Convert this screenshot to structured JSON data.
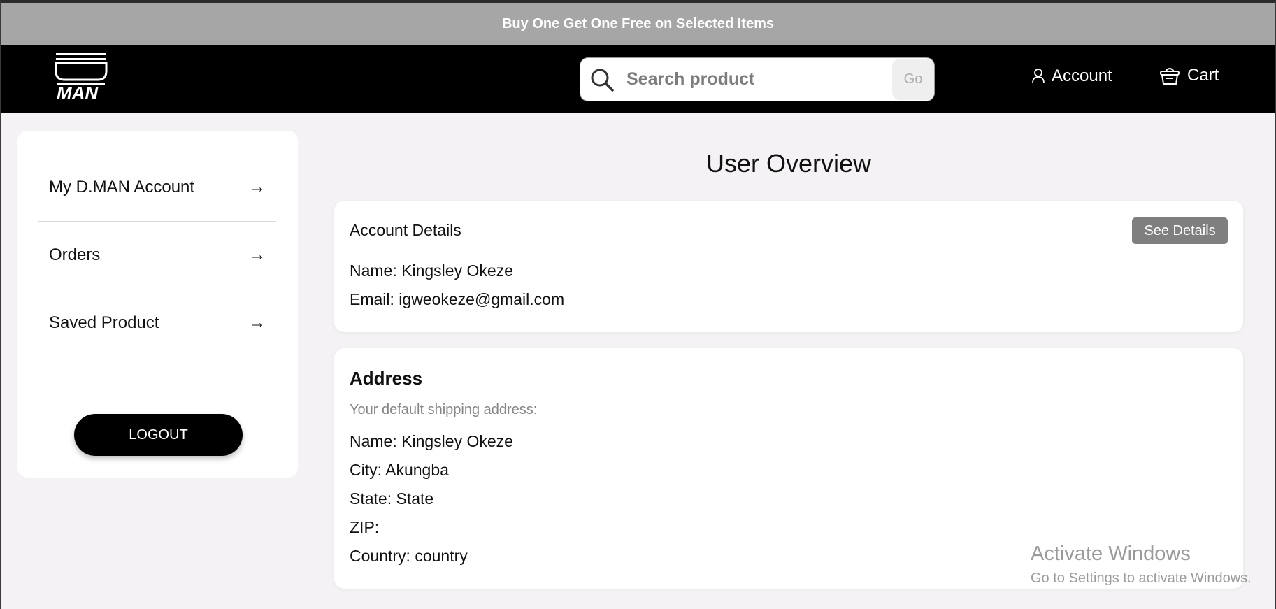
{
  "promo": {
    "text": "Buy One Get One Free on Selected Items"
  },
  "header": {
    "logo_text": "MAN",
    "search": {
      "placeholder": "Search product",
      "value": "",
      "go_label": "Go"
    },
    "account_label": "Account",
    "cart_label": "Cart"
  },
  "sidebar": {
    "items": [
      {
        "label": "My D.MAN Account",
        "arrow": "→"
      },
      {
        "label": "Orders",
        "arrow": "→"
      },
      {
        "label": "Saved Product",
        "arrow": "→"
      }
    ],
    "logout_label": "LOGOUT"
  },
  "main": {
    "title": "User Overview",
    "account": {
      "label": "Account Details",
      "see_details_label": "See Details",
      "name": "Name: Kingsley Okeze",
      "email": "Email: igweokeze@gmail.com"
    },
    "address": {
      "title": "Address",
      "subtitle": "Your default shipping address:",
      "name": "Name: Kingsley Okeze",
      "city": "City: Akungba",
      "state": "State: State",
      "zip": "ZIP:",
      "country": "Country: country"
    }
  },
  "watermark": {
    "line1": "Activate Windows",
    "line2": "Go to Settings to activate Windows."
  },
  "colors": {
    "promo_bg": "#a6a6a6",
    "header_bg": "#000000",
    "page_bg": "#f4f2f4",
    "button_gray": "#7f7f7f"
  }
}
